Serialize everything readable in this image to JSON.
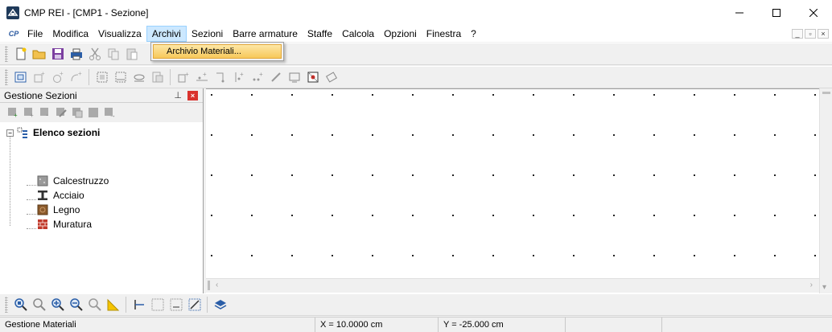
{
  "window": {
    "title": "CMP REI - [CMP1 - Sezione]"
  },
  "menu": {
    "logo": "CP",
    "items": [
      {
        "label": "File"
      },
      {
        "label": "Modifica"
      },
      {
        "label": "Visualizza"
      },
      {
        "label": "Archivi",
        "active": true
      },
      {
        "label": "Sezioni"
      },
      {
        "label": "Barre armature"
      },
      {
        "label": "Staffe"
      },
      {
        "label": "Calcola"
      },
      {
        "label": "Opzioni"
      },
      {
        "label": "Finestra"
      },
      {
        "label": "?"
      }
    ],
    "dropdown": {
      "items": [
        {
          "label": "Archivio Materiali..."
        }
      ]
    }
  },
  "panel": {
    "title": "Gestione Sezioni",
    "tree": {
      "root": "Elenco sezioni",
      "children": [
        {
          "label": "Calcestruzzo",
          "icon": "concrete-icon"
        },
        {
          "label": "Acciaio",
          "icon": "steel-beam-icon"
        },
        {
          "label": "Legno",
          "icon": "wood-icon"
        },
        {
          "label": "Muratura",
          "icon": "brick-icon"
        }
      ]
    }
  },
  "status": {
    "message": "Gestione Materiali",
    "x": "X = 10.0000 cm",
    "y": "Y = -25.000 cm"
  },
  "colors": {
    "accent": "#cce8ff",
    "highlight": "#f7c85a",
    "close_red": "#d9322d"
  }
}
